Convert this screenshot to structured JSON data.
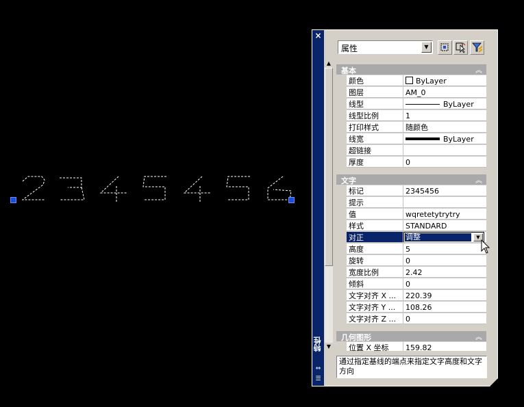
{
  "canvas": {
    "text_value": "2345456"
  },
  "palette": {
    "title": "特性",
    "close_glyph": "×",
    "selector_value": "属性",
    "description": "通过指定基线的端点来指定文字高度和文字方向",
    "sections": {
      "basic": {
        "label": "基本",
        "rows": [
          {
            "name": "颜色",
            "value": "ByLayer"
          },
          {
            "name": "图层",
            "value": "AM_0"
          },
          {
            "name": "线型",
            "value": "ByLayer"
          },
          {
            "name": "线型比例",
            "value": "1"
          },
          {
            "name": "打印样式",
            "value": "随颜色"
          },
          {
            "name": "线宽",
            "value": "ByLayer"
          },
          {
            "name": "超链接",
            "value": ""
          },
          {
            "name": "厚度",
            "value": "0"
          }
        ]
      },
      "text": {
        "label": "文字",
        "rows": [
          {
            "name": "标记",
            "value": "2345456"
          },
          {
            "name": "提示",
            "value": ""
          },
          {
            "name": "值",
            "value": "wqretetytrytry"
          },
          {
            "name": "样式",
            "value": "STANDARD"
          },
          {
            "name": "对正",
            "value": "调整"
          },
          {
            "name": "高度",
            "value": "5"
          },
          {
            "name": "旋转",
            "value": "0"
          },
          {
            "name": "宽度比例",
            "value": "2.42"
          },
          {
            "name": "倾斜",
            "value": "0"
          },
          {
            "name": "文字对齐 X ...",
            "value": "220.39"
          },
          {
            "name": "文字对齐 Y ...",
            "value": "108.26"
          },
          {
            "name": "文字对齐 Z ...",
            "value": "0"
          }
        ]
      },
      "geometry": {
        "label": "几何图形",
        "rows": [
          {
            "name": "位置 X 坐标",
            "value": "159.82"
          }
        ]
      }
    },
    "icons": {
      "quick_select": "quick-select-icon",
      "select_objects": "select-objects-icon",
      "toggle_pickadd": "filter-icon"
    }
  }
}
